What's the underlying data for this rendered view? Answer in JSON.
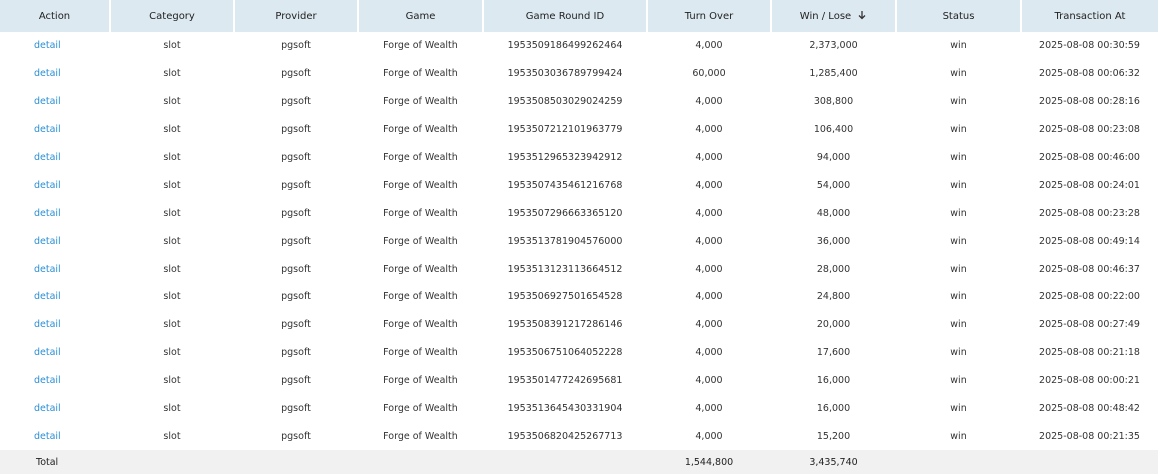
{
  "columns": {
    "action": "Action",
    "category": "Category",
    "provider": "Provider",
    "game": "Game",
    "round_id": "Game Round ID",
    "turn_over": "Turn Over",
    "win_lose": "Win / Lose",
    "status": "Status",
    "transaction_at": "Transaction At"
  },
  "sort": {
    "column": "win_lose",
    "direction": "descending",
    "icon": "arrow-down-icon"
  },
  "colors": {
    "link": "#2a8fd6",
    "header_bg": "#dde9f1",
    "footer_bg": "#f1f1f1"
  },
  "rows": [
    {
      "action": "detail",
      "category": "slot",
      "provider": "pgsoft",
      "game": "Forge of Wealth",
      "round_id": "1953509186499262464",
      "turn_over": "4,000",
      "win_lose": "2,373,000",
      "status": "win",
      "transaction_at": "2025-08-08 00:30:59"
    },
    {
      "action": "detail",
      "category": "slot",
      "provider": "pgsoft",
      "game": "Forge of Wealth",
      "round_id": "1953503036789799424",
      "turn_over": "60,000",
      "win_lose": "1,285,400",
      "status": "win",
      "transaction_at": "2025-08-08 00:06:32"
    },
    {
      "action": "detail",
      "category": "slot",
      "provider": "pgsoft",
      "game": "Forge of Wealth",
      "round_id": "1953508503029024259",
      "turn_over": "4,000",
      "win_lose": "308,800",
      "status": "win",
      "transaction_at": "2025-08-08 00:28:16"
    },
    {
      "action": "detail",
      "category": "slot",
      "provider": "pgsoft",
      "game": "Forge of Wealth",
      "round_id": "1953507212101963779",
      "turn_over": "4,000",
      "win_lose": "106,400",
      "status": "win",
      "transaction_at": "2025-08-08 00:23:08"
    },
    {
      "action": "detail",
      "category": "slot",
      "provider": "pgsoft",
      "game": "Forge of Wealth",
      "round_id": "1953512965323942912",
      "turn_over": "4,000",
      "win_lose": "94,000",
      "status": "win",
      "transaction_at": "2025-08-08 00:46:00"
    },
    {
      "action": "detail",
      "category": "slot",
      "provider": "pgsoft",
      "game": "Forge of Wealth",
      "round_id": "1953507435461216768",
      "turn_over": "4,000",
      "win_lose": "54,000",
      "status": "win",
      "transaction_at": "2025-08-08 00:24:01"
    },
    {
      "action": "detail",
      "category": "slot",
      "provider": "pgsoft",
      "game": "Forge of Wealth",
      "round_id": "1953507296663365120",
      "turn_over": "4,000",
      "win_lose": "48,000",
      "status": "win",
      "transaction_at": "2025-08-08 00:23:28"
    },
    {
      "action": "detail",
      "category": "slot",
      "provider": "pgsoft",
      "game": "Forge of Wealth",
      "round_id": "1953513781904576000",
      "turn_over": "4,000",
      "win_lose": "36,000",
      "status": "win",
      "transaction_at": "2025-08-08 00:49:14"
    },
    {
      "action": "detail",
      "category": "slot",
      "provider": "pgsoft",
      "game": "Forge of Wealth",
      "round_id": "1953513123113664512",
      "turn_over": "4,000",
      "win_lose": "28,000",
      "status": "win",
      "transaction_at": "2025-08-08 00:46:37"
    },
    {
      "action": "detail",
      "category": "slot",
      "provider": "pgsoft",
      "game": "Forge of Wealth",
      "round_id": "1953506927501654528",
      "turn_over": "4,000",
      "win_lose": "24,800",
      "status": "win",
      "transaction_at": "2025-08-08 00:22:00"
    },
    {
      "action": "detail",
      "category": "slot",
      "provider": "pgsoft",
      "game": "Forge of Wealth",
      "round_id": "1953508391217286146",
      "turn_over": "4,000",
      "win_lose": "20,000",
      "status": "win",
      "transaction_at": "2025-08-08 00:27:49"
    },
    {
      "action": "detail",
      "category": "slot",
      "provider": "pgsoft",
      "game": "Forge of Wealth",
      "round_id": "1953506751064052228",
      "turn_over": "4,000",
      "win_lose": "17,600",
      "status": "win",
      "transaction_at": "2025-08-08 00:21:18"
    },
    {
      "action": "detail",
      "category": "slot",
      "provider": "pgsoft",
      "game": "Forge of Wealth",
      "round_id": "1953501477242695681",
      "turn_over": "4,000",
      "win_lose": "16,000",
      "status": "win",
      "transaction_at": "2025-08-08 00:00:21"
    },
    {
      "action": "detail",
      "category": "slot",
      "provider": "pgsoft",
      "game": "Forge of Wealth",
      "round_id": "1953513645430331904",
      "turn_over": "4,000",
      "win_lose": "16,000",
      "status": "win",
      "transaction_at": "2025-08-08 00:48:42"
    },
    {
      "action": "detail",
      "category": "slot",
      "provider": "pgsoft",
      "game": "Forge of Wealth",
      "round_id": "1953506820425267713",
      "turn_over": "4,000",
      "win_lose": "15,200",
      "status": "win",
      "transaction_at": "2025-08-08 00:21:35"
    }
  ],
  "totals": {
    "label": "Total",
    "turn_over": "1,544,800",
    "win_lose": "3,435,740"
  }
}
